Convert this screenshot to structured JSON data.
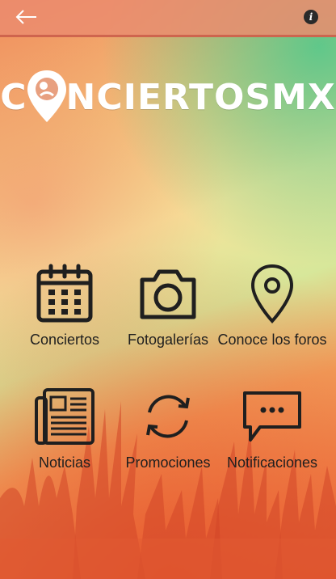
{
  "header": {
    "back_icon": "arrow-left-icon",
    "info_icon": "info-icon",
    "info_glyph": "i"
  },
  "logo": {
    "before_pin": "C",
    "after_pin": "NCIERTOSMX"
  },
  "menu": {
    "items": [
      {
        "label": "Conciertos",
        "icon": "calendar-icon"
      },
      {
        "label": "Fotogalerías",
        "icon": "camera-icon"
      },
      {
        "label": "Conoce los foros",
        "icon": "map-pin-icon"
      },
      {
        "label": "Noticias",
        "icon": "newspaper-icon"
      },
      {
        "label": "Promociones",
        "icon": "refresh-icon"
      },
      {
        "label": "Notificaciones",
        "icon": "chat-bubble-icon"
      }
    ]
  },
  "colors": {
    "icon_stroke": "#1f1f1f",
    "topbar": "#eb8c6e",
    "accent_green": "#46c88c"
  }
}
